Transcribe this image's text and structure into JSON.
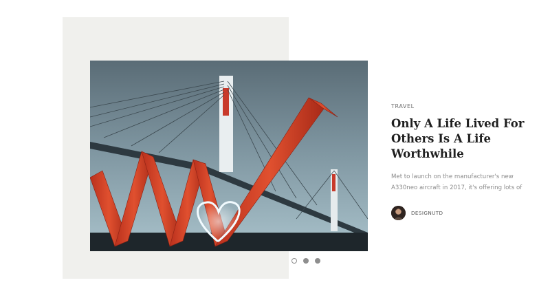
{
  "post": {
    "category": "TRAVEL",
    "title": "Only A Life Lived For Others Is A Life Worthwhile",
    "excerpt": "Met to launch on the manufacturer's new A330neo aircraft in 2017, it's offering lots of",
    "author": "DESIGNUTD",
    "image_icon": "bridge-container-sculpture-photo",
    "avatar_icon": "author-avatar"
  },
  "slider": {
    "count": 3,
    "active_index": 0
  },
  "colors": {
    "panel": "#f0f0ed",
    "accent_red": "#d9432a",
    "title_text": "#1f1f1f"
  }
}
